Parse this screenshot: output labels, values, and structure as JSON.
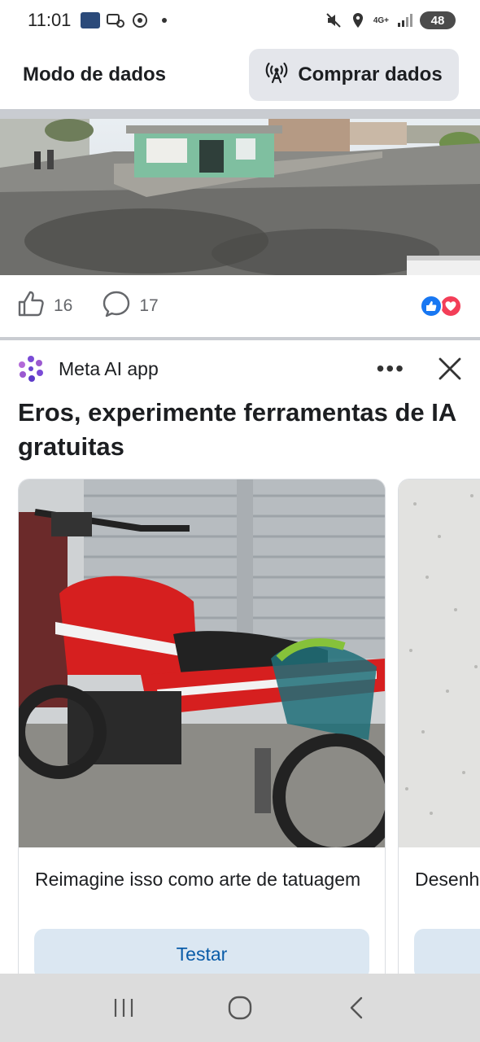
{
  "status_bar": {
    "time": "11:01",
    "battery": "48",
    "network": "4G+",
    "icons": [
      "gallery-app-icon",
      "voicemail-icon",
      "chrome-icon",
      "dot-icon",
      "mute-icon",
      "location-icon",
      "signal-icon"
    ]
  },
  "data_header": {
    "mode_label": "Modo de dados",
    "buy_label": "Comprar dados",
    "buy_icon": "antenna-icon"
  },
  "post": {
    "like_count": "16",
    "comment_count": "17",
    "reaction_icons": [
      "like-reaction-icon",
      "love-reaction-icon"
    ]
  },
  "ad": {
    "app_name": "Meta AI app",
    "title": "Eros, experimente ferramentas de IA gratuitas",
    "cards": [
      {
        "caption": "Reimagine isso como arte de tatuagem",
        "button": "Testar"
      },
      {
        "caption": "Desenh",
        "button": ""
      }
    ]
  },
  "nav": {
    "buttons": [
      "recents-icon",
      "home-icon",
      "back-icon"
    ]
  },
  "colors": {
    "accent_blue": "#1877f2",
    "love_red": "#f33e58",
    "button_bg": "#dbe7f2",
    "button_text": "#0a5ca8"
  }
}
